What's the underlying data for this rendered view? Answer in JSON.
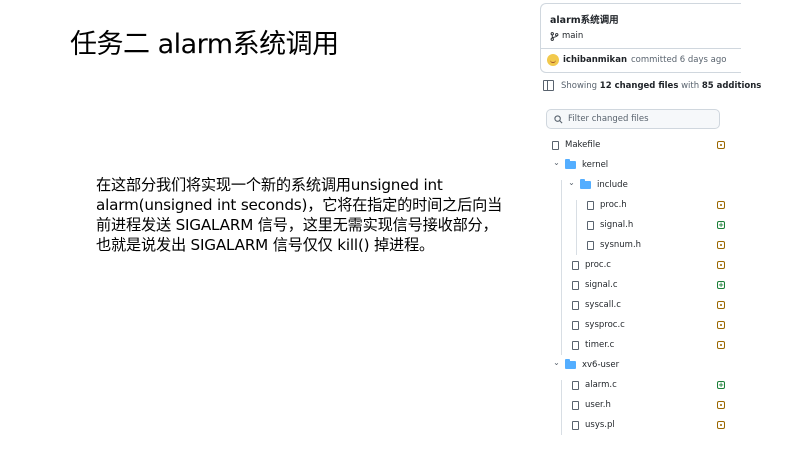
{
  "slide": {
    "title": "任务二 alarm系统调用",
    "body": "在这部分我们将实现一个新的系统调用unsigned int alarm(unsigned int seconds)，它将在指定的时间之后向当前进程发送 SIGALARM 信号，这里无需实现信号接收部分，也就是说发出 SIGALARM 信号仅仅 kill() 掉进程。"
  },
  "github": {
    "commit_title": "alarm系统调用",
    "branch": "main",
    "author": "ichibanmikan",
    "commit_text": "committed 6 days ago",
    "showing_prefix": "Showing ",
    "changed_files": "12 changed files",
    "with_text": " with ",
    "additions": "85 additions",
    "filter_placeholder": "Filter changed files",
    "tree": [
      {
        "name": "Makefile",
        "type": "file",
        "depth": 0,
        "status": "modified"
      },
      {
        "name": "kernel",
        "type": "folder",
        "depth": 0
      },
      {
        "name": "include",
        "type": "folder",
        "depth": 1
      },
      {
        "name": "proc.h",
        "type": "file",
        "depth": 2,
        "status": "modified"
      },
      {
        "name": "signal.h",
        "type": "file",
        "depth": 2,
        "status": "added"
      },
      {
        "name": "sysnum.h",
        "type": "file",
        "depth": 2,
        "status": "modified"
      },
      {
        "name": "proc.c",
        "type": "file",
        "depth": 1,
        "status": "modified"
      },
      {
        "name": "signal.c",
        "type": "file",
        "depth": 1,
        "status": "added"
      },
      {
        "name": "syscall.c",
        "type": "file",
        "depth": 1,
        "status": "modified"
      },
      {
        "name": "sysproc.c",
        "type": "file",
        "depth": 1,
        "status": "modified"
      },
      {
        "name": "timer.c",
        "type": "file",
        "depth": 1,
        "status": "modified"
      },
      {
        "name": "xv6-user",
        "type": "folder",
        "depth": 0
      },
      {
        "name": "alarm.c",
        "type": "file",
        "depth": 1,
        "status": "added"
      },
      {
        "name": "user.h",
        "type": "file",
        "depth": 1,
        "status": "modified"
      },
      {
        "name": "usys.pl",
        "type": "file",
        "depth": 1,
        "status": "modified"
      }
    ]
  }
}
